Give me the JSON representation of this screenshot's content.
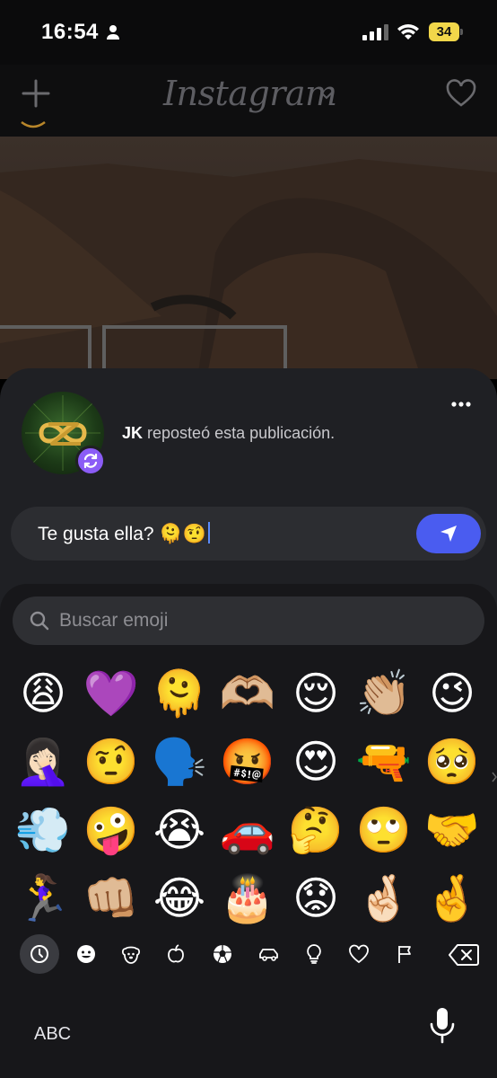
{
  "status_bar": {
    "time": "16:54",
    "battery": "34"
  },
  "header": {
    "logo": "Instagram"
  },
  "repost": {
    "user": "JK",
    "text": "reposteó esta publicación."
  },
  "comment": {
    "text": "Te gusta ella? 🫠🤨"
  },
  "keyboard": {
    "search_placeholder": "Buscar emoji",
    "abc_label": "ABC",
    "emoji_rows": [
      [
        "😩",
        "💜",
        "🫠",
        "🫶🏼",
        "😌",
        "👏🏼",
        "😉"
      ],
      [
        "🤦🏻‍♀️",
        "🤨",
        "🗣️",
        "🤬",
        "😍",
        "🔫",
        "🥺"
      ],
      [
        "💨",
        "🤪",
        "😭",
        "🚗",
        "🤔",
        "🙄",
        "🤝"
      ],
      [
        "🏃‍♀️",
        "👊🏼",
        "😂",
        "🎂",
        "😟",
        "🤞🏻",
        "🤞"
      ]
    ],
    "categories": [
      "recent-icon",
      "smileys-icon",
      "animals-icon",
      "food-icon",
      "activity-icon",
      "travel-icon",
      "objects-icon",
      "symbols-icon",
      "flags-icon"
    ]
  }
}
